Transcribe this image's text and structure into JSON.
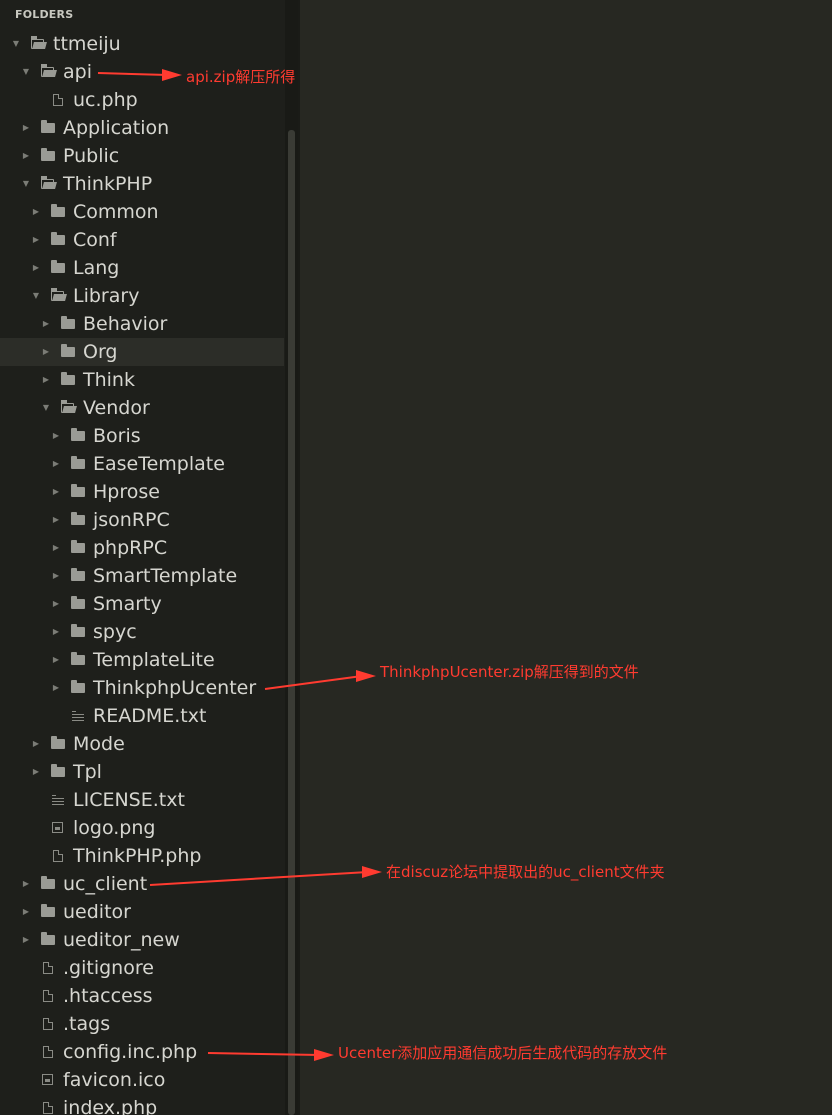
{
  "sidebar": {
    "header": "FOLDERS",
    "rows": [
      {
        "label": "ttmeiju",
        "type": "folder",
        "expanded": true,
        "depth": 0
      },
      {
        "label": "api",
        "type": "folder",
        "expanded": true,
        "depth": 1
      },
      {
        "label": "uc.php",
        "type": "file",
        "depth": 2
      },
      {
        "label": "Application",
        "type": "folder",
        "expanded": false,
        "depth": 1
      },
      {
        "label": "Public",
        "type": "folder",
        "expanded": false,
        "depth": 1
      },
      {
        "label": "ThinkPHP",
        "type": "folder",
        "expanded": true,
        "depth": 1
      },
      {
        "label": "Common",
        "type": "folder",
        "expanded": false,
        "depth": 2
      },
      {
        "label": "Conf",
        "type": "folder",
        "expanded": false,
        "depth": 2
      },
      {
        "label": "Lang",
        "type": "folder",
        "expanded": false,
        "depth": 2
      },
      {
        "label": "Library",
        "type": "folder",
        "expanded": true,
        "depth": 2
      },
      {
        "label": "Behavior",
        "type": "folder",
        "expanded": false,
        "depth": 3
      },
      {
        "label": "Org",
        "type": "folder",
        "expanded": false,
        "depth": 3,
        "selected": true
      },
      {
        "label": "Think",
        "type": "folder",
        "expanded": false,
        "depth": 3
      },
      {
        "label": "Vendor",
        "type": "folder",
        "expanded": true,
        "depth": 3
      },
      {
        "label": "Boris",
        "type": "folder",
        "expanded": false,
        "depth": 4
      },
      {
        "label": "EaseTemplate",
        "type": "folder",
        "expanded": false,
        "depth": 4
      },
      {
        "label": "Hprose",
        "type": "folder",
        "expanded": false,
        "depth": 4
      },
      {
        "label": "jsonRPC",
        "type": "folder",
        "expanded": false,
        "depth": 4
      },
      {
        "label": "phpRPC",
        "type": "folder",
        "expanded": false,
        "depth": 4
      },
      {
        "label": "SmartTemplate",
        "type": "folder",
        "expanded": false,
        "depth": 4
      },
      {
        "label": "Smarty",
        "type": "folder",
        "expanded": false,
        "depth": 4
      },
      {
        "label": "spyc",
        "type": "folder",
        "expanded": false,
        "depth": 4
      },
      {
        "label": "TemplateLite",
        "type": "folder",
        "expanded": false,
        "depth": 4
      },
      {
        "label": "ThinkphpUcenter",
        "type": "folder",
        "expanded": false,
        "depth": 4
      },
      {
        "label": "README.txt",
        "type": "text",
        "depth": 4
      },
      {
        "label": "Mode",
        "type": "folder",
        "expanded": false,
        "depth": 2
      },
      {
        "label": "Tpl",
        "type": "folder",
        "expanded": false,
        "depth": 2
      },
      {
        "label": "LICENSE.txt",
        "type": "text",
        "depth": 2
      },
      {
        "label": "logo.png",
        "type": "image",
        "depth": 2
      },
      {
        "label": "ThinkPHP.php",
        "type": "file",
        "depth": 2
      },
      {
        "label": "uc_client",
        "type": "folder",
        "expanded": false,
        "depth": 1
      },
      {
        "label": "ueditor",
        "type": "folder",
        "expanded": false,
        "depth": 1
      },
      {
        "label": "ueditor_new",
        "type": "folder",
        "expanded": false,
        "depth": 1
      },
      {
        "label": ".gitignore",
        "type": "file",
        "depth": 1
      },
      {
        "label": ".htaccess",
        "type": "file",
        "depth": 1
      },
      {
        "label": ".tags",
        "type": "file",
        "depth": 1
      },
      {
        "label": "config.inc.php",
        "type": "file",
        "depth": 1
      },
      {
        "label": "favicon.ico",
        "type": "image",
        "depth": 1
      },
      {
        "label": "index.php",
        "type": "file",
        "depth": 1
      }
    ]
  },
  "annotations": [
    {
      "text": "api.zip解压所得",
      "row": 1
    },
    {
      "text": "ThinkphpUcenter.zip解压得到的文件",
      "row": 23
    },
    {
      "text": "在discuz论坛中提取出的uc_client文件夹",
      "row": 30
    },
    {
      "text": "Ucenter添加应用通信成功后生成代码的存放文件",
      "row": 36
    }
  ],
  "colors": {
    "annotation": "#ff3b30",
    "sidebar_bg": "#1e1f1b",
    "editor_bg": "#272822",
    "text": "#d6d6d0"
  }
}
